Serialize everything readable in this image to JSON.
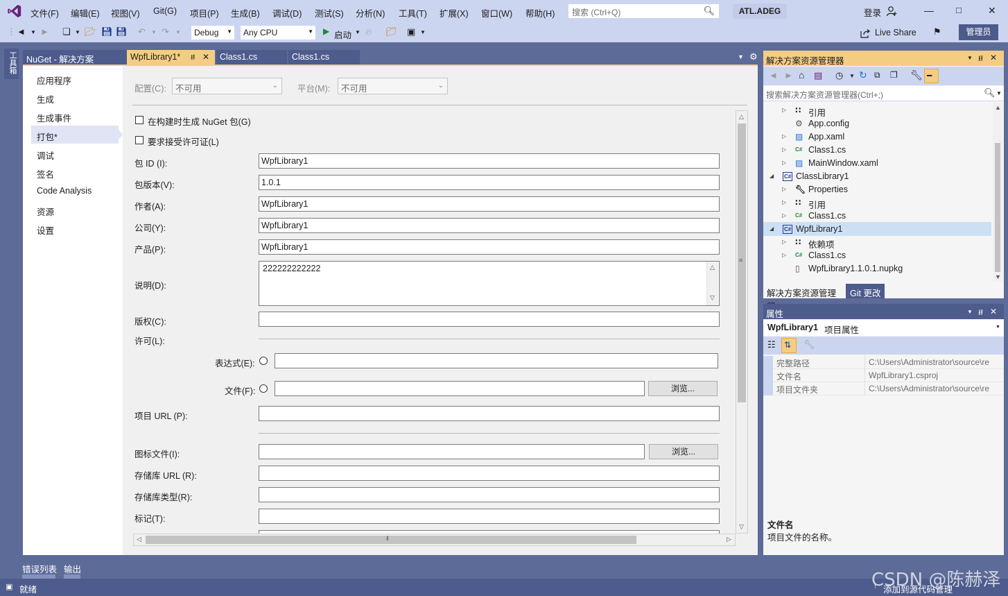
{
  "menubar": {
    "items": [
      "文件(F)",
      "编辑(E)",
      "视图(V)",
      "Git(G)",
      "项目(P)",
      "生成(B)",
      "调试(D)",
      "测试(S)",
      "分析(N)",
      "工具(T)",
      "扩展(X)",
      "窗口(W)",
      "帮助(H)"
    ],
    "search_placeholder": "搜索 (Ctrl+Q)",
    "solution_name": "ATL.ADEG",
    "login": "登录"
  },
  "toolbar": {
    "config": "Debug",
    "platform": "Any CPU",
    "start": "启动",
    "live_share": "Live Share",
    "admin": "管理员"
  },
  "left_strip": {
    "toolbox": "工具箱"
  },
  "tabs": [
    "NuGet - 解决方案",
    "WpfLibrary1*",
    "Class1.cs",
    "Class1.cs"
  ],
  "nav": {
    "items": [
      "应用程序",
      "生成",
      "生成事件",
      "打包*",
      "调试",
      "签名",
      "Code Analysis",
      "资源",
      "设置"
    ],
    "selected": "打包*"
  },
  "config_bar": {
    "config_label": "配置(C):",
    "config_value": "不可用",
    "platform_label": "平台(M):",
    "platform_value": "不可用"
  },
  "package": {
    "gen_on_build": "在构建时生成 NuGet 包(G)",
    "require_license": "要求接受许可证(L)",
    "id_label": "包 ID (I):",
    "id_value": "WpfLibrary1",
    "version_label": "包版本(V):",
    "version_value": "1.0.1",
    "authors_label": "作者(A):",
    "authors_value": "WpfLibrary1",
    "company_label": "公司(Y):",
    "company_value": "WpfLibrary1",
    "product_label": "产品(P):",
    "product_value": "WpfLibrary1",
    "desc_label": "说明(D):",
    "desc_value": "222222222222",
    "copyright_label": "版权(C):",
    "license_label": "许可(L):",
    "expression_label": "表达式(E):",
    "file_label": "文件(F):",
    "browse": "浏览...",
    "project_url_label": "项目 URL (P):",
    "icon_file_label": "图标文件(I):",
    "repo_url_label": "存储库 URL (R):",
    "repo_type_label": "存储库类型(R):",
    "tags_label": "标记(T):"
  },
  "solution_explorer": {
    "title": "解决方案资源管理器",
    "search_placeholder": "搜索解决方案资源管理器(Ctrl+;)",
    "items": [
      {
        "label": "引用",
        "icon": "references-icon",
        "exp": "▷"
      },
      {
        "label": "App.config",
        "icon": "config-file-icon",
        "exp": ""
      },
      {
        "label": "App.xaml",
        "icon": "xaml-file-icon",
        "exp": "▷"
      },
      {
        "label": "Class1.cs",
        "icon": "csharp-file-icon",
        "exp": "▷"
      },
      {
        "label": "MainWindow.xaml",
        "icon": "xaml-file-icon",
        "exp": "▷"
      },
      {
        "label": "ClassLibrary1",
        "icon": "csharp-project-icon",
        "exp": "◢"
      },
      {
        "label": "Properties",
        "icon": "wrench-icon",
        "exp": "▷"
      },
      {
        "label": "引用",
        "icon": "references-icon",
        "exp": "▷"
      },
      {
        "label": "Class1.cs",
        "icon": "csharp-file-icon",
        "exp": "▷"
      },
      {
        "label": "WpfLibrary1",
        "icon": "csharp-project-icon",
        "exp": "◢"
      },
      {
        "label": "依赖项",
        "icon": "dependencies-icon",
        "exp": "▷"
      },
      {
        "label": "Class1.cs",
        "icon": "csharp-file-icon",
        "exp": "▷"
      },
      {
        "label": "WpfLibrary1.1.0.1.nupkg",
        "icon": "file-icon",
        "exp": ""
      }
    ],
    "bottom_tabs": [
      "解决方案资源管理器",
      "Git 更改"
    ]
  },
  "properties": {
    "title": "属性",
    "object_name": "WpfLibrary1",
    "object_type": "项目属性",
    "rows": [
      {
        "name": "完整路径",
        "value": "C:\\Users\\Administrator\\source\\re"
      },
      {
        "name": "文件名",
        "value": "WpfLibrary1.csproj"
      },
      {
        "name": "项目文件夹",
        "value": "C:\\Users\\Administrator\\source\\re"
      }
    ],
    "desc_title": "文件名",
    "desc_text": "项目文件的名称。"
  },
  "bottom_tabs": [
    "错误列表",
    "输出"
  ],
  "status": {
    "ready": "就绪",
    "add_source": "添加到源代码管理"
  },
  "watermark": "CSDN @陈赫泽"
}
